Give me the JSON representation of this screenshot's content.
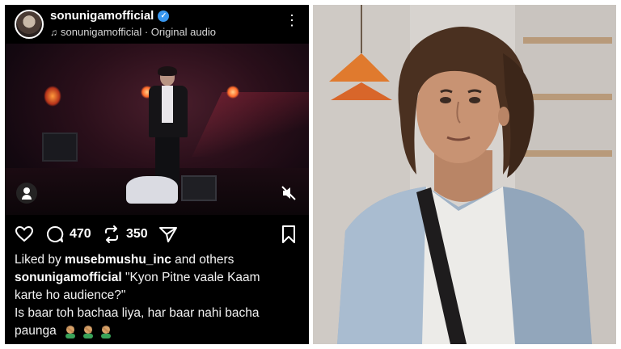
{
  "post": {
    "username": "sonunigamofficial",
    "audio": "sonunigamofficial · Original audio",
    "comment_count": "470",
    "repost_count": "350",
    "liked_by_prefix": "Liked by",
    "liked_by_user": "musebmushu_inc",
    "liked_by_suffix": "and others",
    "caption_user": "sonunigamofficial",
    "caption_line1": "\"Kyon Pitne vaale Kaam",
    "caption_line2": "karte ho audience?\"",
    "caption_line3": "Is baar toh bachaa liya, har baar nahi bacha",
    "caption_line4": "paunga"
  },
  "icons": {
    "verified": "verified-badge-icon",
    "music": "music-note-icon",
    "more": "more-options-icon",
    "profile": "user-icon",
    "mute": "speaker-muted-icon",
    "like": "heart-icon",
    "comment": "comment-bubble-icon",
    "repost": "repost-icon",
    "share": "send-icon",
    "save": "bookmark-icon",
    "emoji": "facepalm-emoji-icon"
  },
  "colors": {
    "post_background": "#000000",
    "verified_blue": "#3897f0",
    "text": "#f5f5f5",
    "page_background": "#ffffff"
  }
}
